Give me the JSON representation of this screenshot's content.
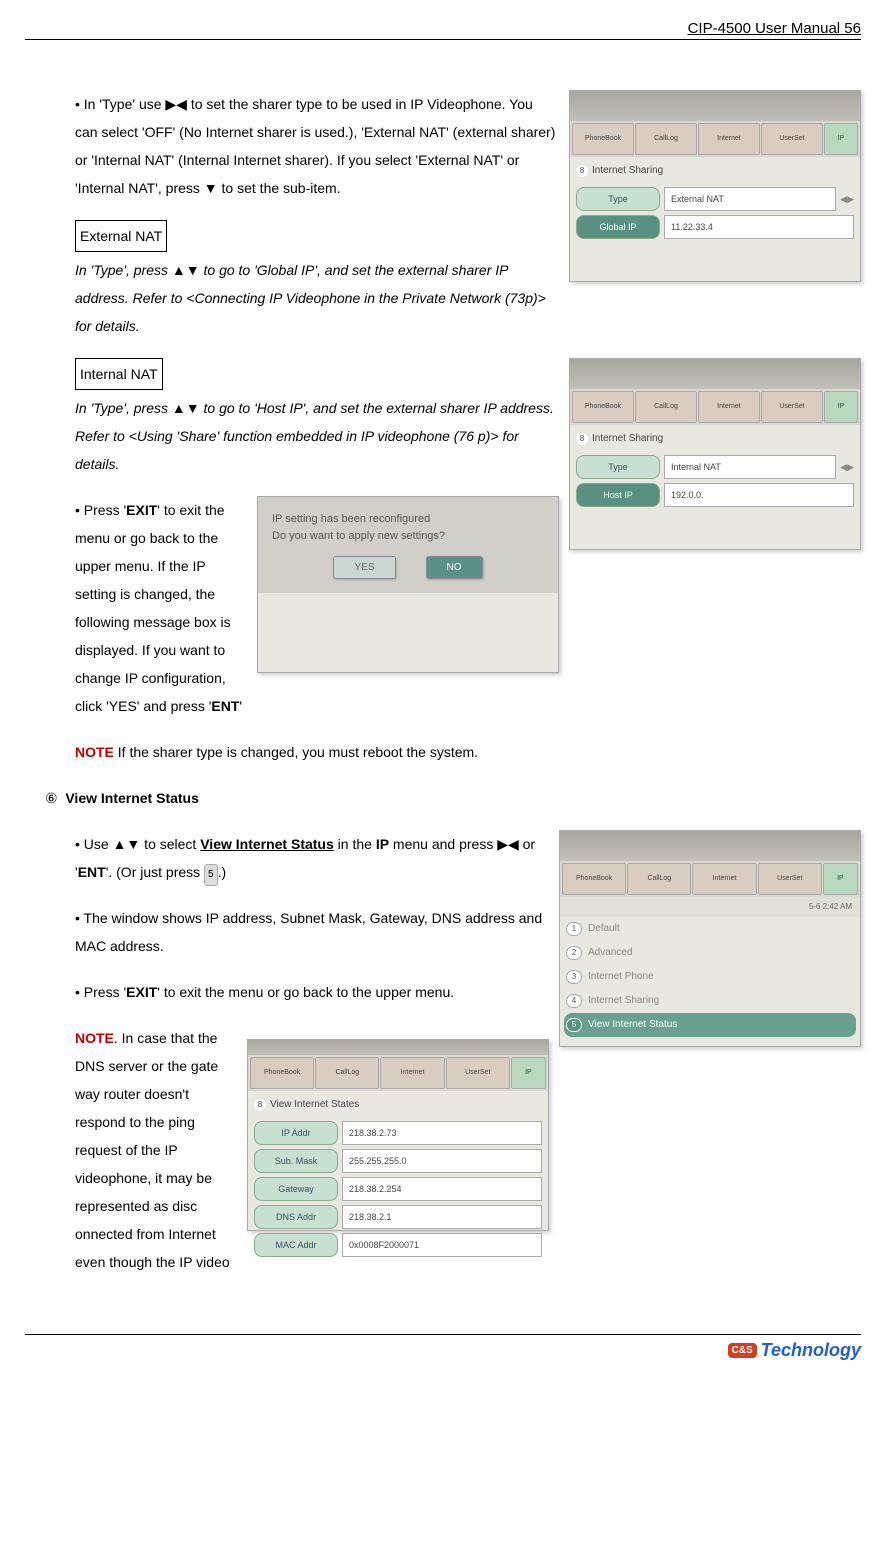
{
  "header": {
    "title": "CIP-4500 User Manual 56"
  },
  "para1": "• In 'Type' use ▶◀ to set the sharer type to be used in IP Videophone. You can select 'OFF' (No Internet sharer is used.), 'External NAT' (external sharer) or 'Internal NAT' (Internal Internet sharer). If you select 'External NAT' or 'Internal NAT', press ▼ to set the sub-item.",
  "ext_nat_label": "External NAT",
  "ext_nat_text_1": "In 'Type', press ▲▼ to go to 'Global IP', and set the external sharer IP address. Refer to <",
  "ext_nat_text_ref": "Connecting IP Videophone in the Private Network",
  "ext_nat_text_2": " (73p)> for details.",
  "int_nat_label": "Internal NAT",
  "int_nat_text_1": "In 'Type', press ▲▼ to go to 'Host IP', and set the external sharer IP address. Refer to <",
  "int_nat_text_ref": "Using 'Share' function embedded in IP videophone",
  "int_nat_text_2": " (76 p)> for details.",
  "exit_para_1": "• Press '",
  "exit_bold": "EXIT",
  "exit_para_2": "' to exit the menu or go back to the upper menu. If the IP setting is changed, the following message box is displayed. If you want to change IP configuration, click 'YES' and press '",
  "ent_bold": "ENT",
  "exit_para_3": "'",
  "note1_label": "NOTE",
  "note1_text": " If the sharer type is changed, you must reboot the system.",
  "section6_num": "⑥",
  "section6_title": "View Internet Status",
  "s6p1_a": "• Use ▲▼ to select ",
  "s6p1_bold": "View Internet Status",
  "s6p1_b": " in the ",
  "s6p1_bold2": "IP",
  "s6p1_c": " menu and press ▶◀ or '",
  "s6p1_bold3": "ENT",
  "s6p1_d": "'. (Or just press ",
  "s6p1_key": "5",
  "s6p1_e": ".)",
  "s6p2": "• The window shows IP address, Subnet Mask, Gateway, DNS address and MAC address.",
  "s6p3_a": "• Press '",
  "s6p3_bold": "EXIT",
  "s6p3_b": "' to exit the menu or go back to the upper menu.",
  "note2_label": "NOTE",
  "note2_text": ".  In case that the DNS server or the gate way router doesn't respond to the ping request of the IP videophone, it may be represented as disc onnected from Internet even though the IP video",
  "tabs": [
    "PhoneBook",
    "CallLog",
    "Internet",
    "UserSet",
    "IP"
  ],
  "shot1": {
    "title": "Internet Sharing",
    "type_label": "Type",
    "type_val": "External NAT",
    "ip_label": "Global IP",
    "ip_val": "11.22.33.4"
  },
  "shot2": {
    "title": "Internet Sharing",
    "type_label": "Type",
    "type_val": "Internal NAT",
    "ip_label": "Host IP",
    "ip_val": "192.0.0."
  },
  "shot3": {
    "msg": "IP setting has been reconfigured\nDo you want to apply new settings?",
    "yes": "YES",
    "no": "NO"
  },
  "shot4": {
    "time": "5-6  2:42 AM",
    "items": [
      "Default",
      "Advanced",
      "Internet Phone",
      "Internet Sharing",
      "View Internet Status"
    ]
  },
  "shot5": {
    "title": "View Internet States",
    "rows": [
      {
        "label": "IP Addr",
        "val": "218.38.2.73"
      },
      {
        "label": "Sub. Mask",
        "val": "255.255.255.0"
      },
      {
        "label": "Gateway",
        "val": "218.38.2.254"
      },
      {
        "label": "DNS Addr",
        "val": "218.38.2.1"
      },
      {
        "label": "MAC Addr",
        "val": "0x0008F2000071"
      }
    ]
  },
  "logo": {
    "badge": "C&S",
    "text": "Technology"
  }
}
